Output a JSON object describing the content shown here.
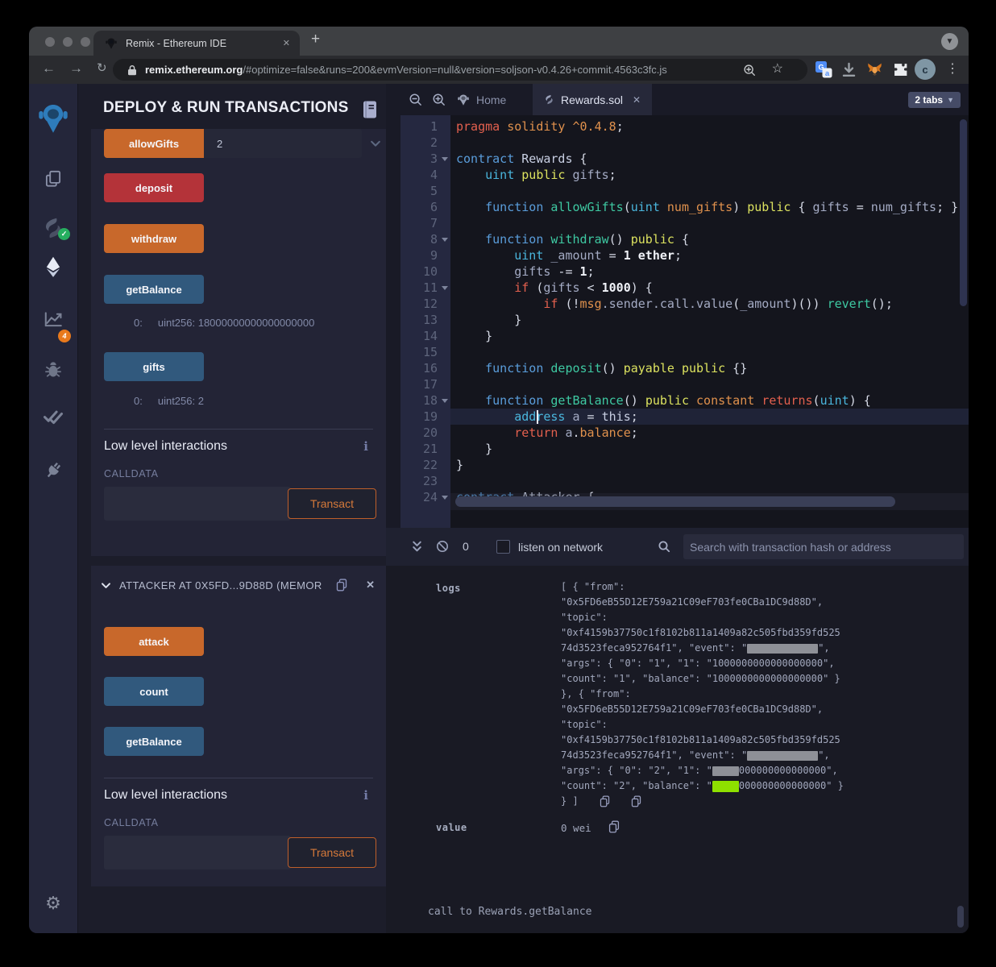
{
  "browser": {
    "tab_title": "Remix - Ethereum IDE",
    "url_host": "remix.ethereum.org",
    "url_rest": "/#optimize=false&runs=200&evmVersion=null&version=soljson-v0.4.26+commit.4563c3fc.js",
    "avatar_letter": "c"
  },
  "rail_badges": {
    "compiler_check": "✓",
    "analytics_count": "4"
  },
  "side_panel": {
    "title": "DEPLOY & RUN TRANSACTIONS",
    "instance_rewards": {
      "functions": [
        {
          "label": "allowGifts",
          "style": "orange",
          "input": "2",
          "expand": true
        },
        {
          "label": "deposit",
          "style": "red"
        },
        {
          "label": "withdraw",
          "style": "orange"
        },
        {
          "label": "getBalance",
          "style": "blue",
          "result": {
            "index": "0:",
            "value": "uint256: 18000000000000000000"
          }
        },
        {
          "label": "gifts",
          "style": "blue",
          "result": {
            "index": "0:",
            "value": "uint256: 2"
          }
        }
      ],
      "low_level_title": "Low level interactions",
      "calldata_label": "CALLDATA",
      "transact_label": "Transact"
    },
    "instance_attacker": {
      "header": "ATTACKER AT 0X5FD...9D88D (MEMOR",
      "functions": [
        {
          "label": "attack",
          "style": "orange"
        },
        {
          "label": "count",
          "style": "blue"
        },
        {
          "label": "getBalance",
          "style": "blue"
        }
      ],
      "low_level_title": "Low level interactions",
      "calldata_label": "CALLDATA",
      "transact_label": "Transact"
    }
  },
  "editor": {
    "tab_home": "Home",
    "tab_file": "Rewards.sol",
    "tabs_badge": "2 tabs",
    "code": [
      {
        "n": "1",
        "t": [
          [
            "pragma",
            "r"
          ],
          [
            " ",
            "d"
          ],
          [
            "solidity",
            "o"
          ],
          [
            " ",
            "d"
          ],
          [
            "^0.4.8",
            "o"
          ],
          [
            ";",
            "d"
          ]
        ]
      },
      {
        "n": "2",
        "t": []
      },
      {
        "n": "3",
        "fold": true,
        "t": [
          [
            "contract",
            "b"
          ],
          [
            " ",
            "d"
          ],
          [
            "Rewards",
            "l"
          ],
          [
            " {",
            "d"
          ]
        ]
      },
      {
        "n": "4",
        "t": [
          [
            "    ",
            "d"
          ],
          [
            "uint",
            "c"
          ],
          [
            " ",
            "d"
          ],
          [
            "public",
            "y"
          ],
          [
            " ",
            "d"
          ],
          [
            "gifts",
            "i"
          ],
          [
            ";",
            "d"
          ]
        ]
      },
      {
        "n": "5",
        "t": []
      },
      {
        "n": "6",
        "t": [
          [
            "    ",
            "d"
          ],
          [
            "function",
            "b"
          ],
          [
            " ",
            "d"
          ],
          [
            "allowGifts",
            "g"
          ],
          [
            "(",
            "d"
          ],
          [
            "uint",
            "c"
          ],
          [
            " ",
            "d"
          ],
          [
            "num_gifts",
            "o"
          ],
          [
            ") ",
            "d"
          ],
          [
            "public",
            "y"
          ],
          [
            " { ",
            "d"
          ],
          [
            "gifts",
            "i"
          ],
          [
            " = ",
            "d"
          ],
          [
            "num_gifts",
            "i"
          ],
          [
            "; }",
            "d"
          ]
        ]
      },
      {
        "n": "7",
        "t": []
      },
      {
        "n": "8",
        "fold": true,
        "t": [
          [
            "    ",
            "d"
          ],
          [
            "function",
            "b"
          ],
          [
            " ",
            "d"
          ],
          [
            "withdraw",
            "g"
          ],
          [
            "() ",
            "d"
          ],
          [
            "public",
            "y"
          ],
          [
            " {",
            "d"
          ]
        ]
      },
      {
        "n": "9",
        "t": [
          [
            "        ",
            "d"
          ],
          [
            "uint",
            "c"
          ],
          [
            " ",
            "d"
          ],
          [
            "_amount",
            "i"
          ],
          [
            " = ",
            "d"
          ],
          [
            "1",
            "w"
          ],
          [
            " ",
            "d"
          ],
          [
            "ether",
            "w"
          ],
          [
            ";",
            "d"
          ]
        ]
      },
      {
        "n": "10",
        "t": [
          [
            "        ",
            "d"
          ],
          [
            "gifts",
            "i"
          ],
          [
            " -= ",
            "d"
          ],
          [
            "1",
            "w"
          ],
          [
            ";",
            "d"
          ]
        ]
      },
      {
        "n": "11",
        "fold": true,
        "t": [
          [
            "        ",
            "d"
          ],
          [
            "if",
            "r"
          ],
          [
            " (",
            "d"
          ],
          [
            "gifts",
            "i"
          ],
          [
            " < ",
            "d"
          ],
          [
            "1000",
            "w"
          ],
          [
            ") {",
            "d"
          ]
        ]
      },
      {
        "n": "12",
        "t": [
          [
            "            ",
            "d"
          ],
          [
            "if",
            "r"
          ],
          [
            " (!",
            "d"
          ],
          [
            "msg",
            "o"
          ],
          [
            ".sender.call.value",
            "i"
          ],
          [
            "(",
            "d"
          ],
          [
            "_amount",
            "i"
          ],
          [
            ")()) ",
            "d"
          ],
          [
            "revert",
            "g"
          ],
          [
            "();",
            "d"
          ]
        ]
      },
      {
        "n": "13",
        "t": [
          [
            "        }",
            "d"
          ]
        ]
      },
      {
        "n": "14",
        "t": [
          [
            "    }",
            "d"
          ]
        ]
      },
      {
        "n": "15",
        "t": []
      },
      {
        "n": "16",
        "t": [
          [
            "    ",
            "d"
          ],
          [
            "function",
            "b"
          ],
          [
            " ",
            "d"
          ],
          [
            "deposit",
            "g"
          ],
          [
            "() ",
            "d"
          ],
          [
            "payable",
            "y"
          ],
          [
            " ",
            "d"
          ],
          [
            "public",
            "y"
          ],
          [
            " {}",
            "d"
          ]
        ]
      },
      {
        "n": "17",
        "t": []
      },
      {
        "n": "18",
        "fold": true,
        "t": [
          [
            "    ",
            "d"
          ],
          [
            "function",
            "b"
          ],
          [
            " ",
            "d"
          ],
          [
            "getBalance",
            "g"
          ],
          [
            "() ",
            "d"
          ],
          [
            "public",
            "y"
          ],
          [
            " ",
            "d"
          ],
          [
            "constant",
            "o"
          ],
          [
            " ",
            "d"
          ],
          [
            "returns",
            "r"
          ],
          [
            "(",
            "d"
          ],
          [
            "uint",
            "c"
          ],
          [
            ") {",
            "d"
          ]
        ]
      },
      {
        "n": "19",
        "cur": true,
        "t": [
          [
            "        ",
            "d"
          ],
          [
            "address",
            "c"
          ],
          [
            " ",
            "d"
          ],
          [
            "a",
            "i"
          ],
          [
            " = ",
            "d"
          ],
          [
            "this",
            "l"
          ],
          [
            ";",
            "d"
          ]
        ]
      },
      {
        "n": "20",
        "t": [
          [
            "        ",
            "d"
          ],
          [
            "return",
            "r"
          ],
          [
            " ",
            "d"
          ],
          [
            "a",
            "i"
          ],
          [
            ".",
            "d"
          ],
          [
            "balance",
            "o"
          ],
          [
            ";",
            "d"
          ]
        ]
      },
      {
        "n": "21",
        "t": [
          [
            "    }",
            "d"
          ]
        ]
      },
      {
        "n": "22",
        "t": [
          [
            "}",
            "d"
          ]
        ]
      },
      {
        "n": "23",
        "t": []
      },
      {
        "n": "24",
        "fold": true,
        "t": [
          [
            "contract",
            "b"
          ],
          [
            " ",
            "d"
          ],
          [
            "Attacker",
            "l"
          ],
          [
            " {",
            "d"
          ]
        ]
      }
    ]
  },
  "terminal": {
    "pending_count": "0",
    "listen_label": "listen on network",
    "search_placeholder": "Search with transaction hash or address",
    "logs_label": "logs",
    "log_lines": [
      [
        [
          "t",
          "[ { \"from\":"
        ]
      ],
      [
        [
          "t",
          "\"0x5FD6eB55D12E759a21C09eF703fe0CBa1DC9d88D\","
        ]
      ],
      [
        [
          "t",
          "\"topic\":"
        ]
      ],
      [
        [
          "t",
          "\"0xf4159b37750c1f8102b811a1409a82c505fbd359fd525"
        ]
      ],
      [
        [
          "t",
          "74d3523feca952764f1\", \"event\": \""
        ],
        [
          "rg",
          88
        ],
        [
          "t",
          "\","
        ]
      ],
      [
        [
          "t",
          "\"args\": { \"0\": \"1\", \"1\": \"1000000000000000000\","
        ]
      ],
      [
        [
          "t",
          "\"count\": \"1\", \"balance\": \"1000000000000000000\" }"
        ]
      ],
      [
        [
          "t",
          "}, { \"from\":"
        ]
      ],
      [
        [
          "t",
          "\"0x5FD6eB55D12E759a21C09eF703fe0CBa1DC9d88D\","
        ]
      ],
      [
        [
          "t",
          "\"topic\":"
        ]
      ],
      [
        [
          "t",
          "\"0xf4159b37750c1f8102b811a1409a82c505fbd359fd525"
        ]
      ],
      [
        [
          "t",
          "74d3523feca952764f1\", \"event\": \""
        ],
        [
          "rg",
          88
        ],
        [
          "t",
          "\","
        ]
      ],
      [
        [
          "t",
          "\"args\": { \"0\": \"2\", \"1\": \""
        ],
        [
          "rg",
          33
        ],
        [
          "t",
          "000000000000000\","
        ]
      ],
      [
        [
          "t",
          "\"count\": \"2\", \"balance\": \""
        ],
        [
          "rl",
          33
        ],
        [
          "t",
          "000000000000000\" }"
        ]
      ],
      [
        [
          "t",
          "} ]"
        ],
        [
          "copy",
          0
        ],
        [
          "copy",
          0
        ]
      ]
    ],
    "value_label": "value",
    "value": "0 wei",
    "status_line": "call to Rewards.getBalance"
  },
  "colors": {
    "accent_orange": "#c8682b",
    "danger_red": "#b43339",
    "info_blue": "#31597d",
    "transact_outline": "#bf5f2a",
    "badge_green": "#27ae60",
    "badge_orange": "#e8791c",
    "redaction_gray": "#8e9097",
    "redaction_lime": "#8ee000"
  }
}
